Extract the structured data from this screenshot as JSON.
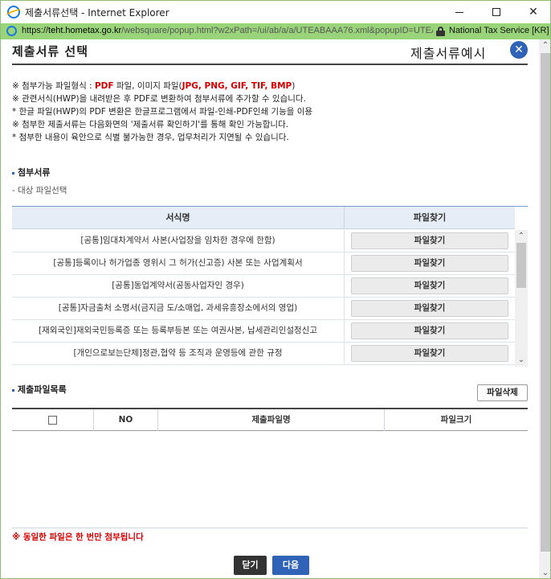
{
  "window": {
    "title": "제출서류선택 - Internet Explorer",
    "minimize_icon": "minimize-icon",
    "maximize_icon": "maximize-icon",
    "close_glyph": "✕"
  },
  "address_bar": {
    "scheme": "https://",
    "host": "teht.hometax.go.kr",
    "path": "/websquare/popup.html?w2xPath=/ui/ab/a/a/UTEABAAA76.xml&popupID=UTEA",
    "site_identity": "National Tax Service [KR]"
  },
  "header": {
    "title": "제출서류 선택",
    "example_title": "제출서류예시",
    "close_glyph": "✕"
  },
  "notices": {
    "line1_pre": "※ 첨부가능 파일형식 : ",
    "line1_pdf": "PDF",
    "line1_mid": " 파일, 이미지 파일(",
    "line1_formats": "JPG, PNG, GIF, TIF, BMP",
    "line1_post": ")",
    "line2": "※ 관련서식(HWP)을 내려받은 후 PDF로 변환하여 첨부서류에 추가할 수 있습니다.",
    "line3": " * 한글 파일(HWP)의 PDF 변환은 한글프로그램에서 파일-인쇄-PDF인쇄 기능을 이용",
    "line4": "※ 첨부한 제출서류는 다음화면의 '제출서류 확인하기'를 통해 확인 가능합니다.",
    "line5": " * 첨부한 내용이 육안으로 식별 불가능한 경우, 업무처리가 지연될 수 있습니다."
  },
  "attachments": {
    "section_label": "첨부서류",
    "sub_label": "- 대상 파일선택",
    "col_form": "서식명",
    "col_find": "파일찾기",
    "rows": [
      {
        "name": "[공통]임대차계약서 사본(사업장을 임차한 경우에 한함)",
        "button": "파일찾기"
      },
      {
        "name": "[공통]등록이나 허가업종 영위시 그 허가(신고증) 사본 또는 사업계획서",
        "button": "파일찾기"
      },
      {
        "name": "[공통]동업계약서(공동사업자인 경우)",
        "button": "파일찾기"
      },
      {
        "name": "[공통]자금출처 소명서(금지금 도/소매업, 과세유흥장소에서의 영업)",
        "button": "파일찾기"
      },
      {
        "name": "[재외국인]재외국민등록증 또는 등록부등본 또는 여권사본, 납세관리인설정신고",
        "button": "파일찾기"
      },
      {
        "name": "[개인으로보는단체]정관,협약 등 조직과 운영등에 관한 규정",
        "button": "파일찾기"
      }
    ]
  },
  "file_list": {
    "section_label": "제출파일목록",
    "delete_button": "파일삭제",
    "col_no": "NO",
    "col_name": "제출파일명",
    "col_size": "파일크기"
  },
  "footer": {
    "warning": "※ 동일한 파일은 한 번만 첨부됩니다",
    "close_button": "닫기",
    "next_button": "다음"
  },
  "colors": {
    "accent": "#2f63b8",
    "warning": "#d40000",
    "address_bar": "#9ad47a"
  }
}
